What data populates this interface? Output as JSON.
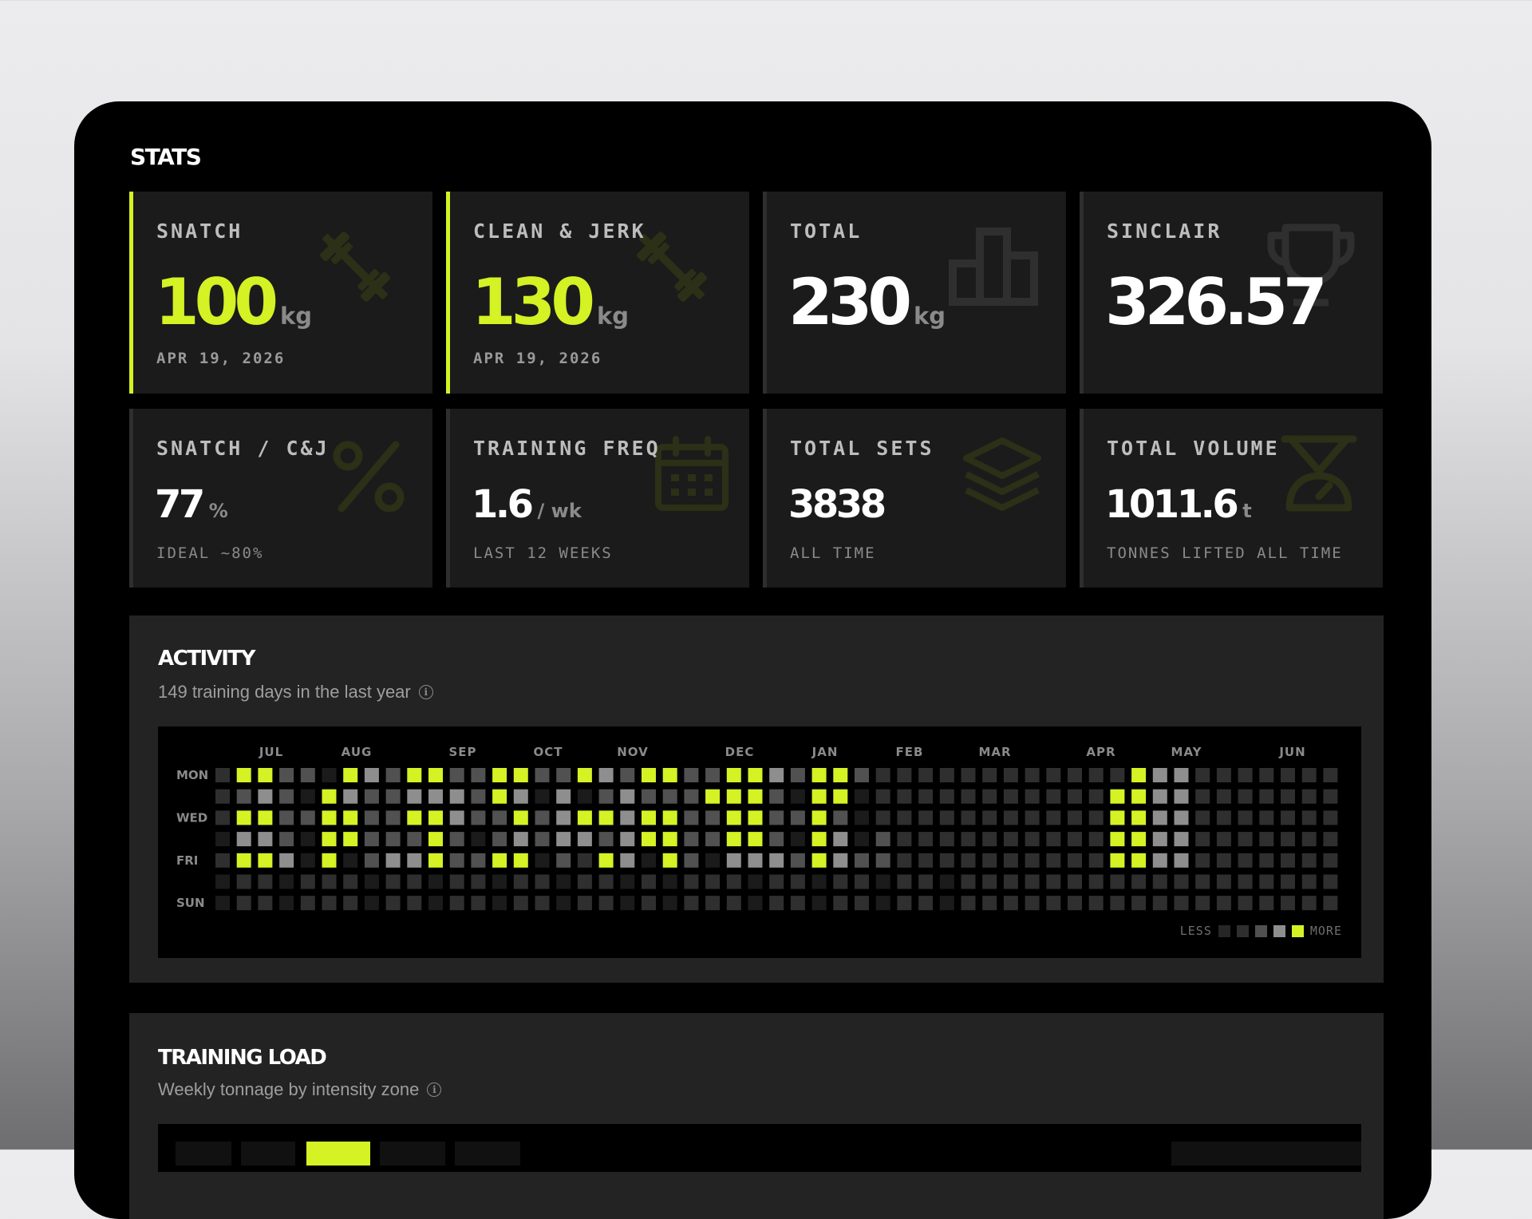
{
  "section_title": "STATS",
  "stats": [
    {
      "label": "SNATCH",
      "value": "100",
      "unit": "kg",
      "sub": "APR 19, 2026",
      "icon": "barbell-icon"
    },
    {
      "label": "CLEAN & JERK",
      "value": "130",
      "unit": "kg",
      "sub": "APR 19, 2026",
      "icon": "barbell-icon"
    },
    {
      "label": "TOTAL",
      "value": "230",
      "unit": "kg",
      "sub": "",
      "icon": "podium-icon"
    },
    {
      "label": "SINCLAIR",
      "value": "326.57",
      "unit": "",
      "sub": "",
      "icon": "trophy-icon"
    },
    {
      "label": "SNATCH / C&J",
      "value": "77",
      "unit": "%",
      "sub": "IDEAL ~80%",
      "icon": "percent-icon"
    },
    {
      "label": "TRAINING FREQ",
      "value": "1.6",
      "unit": "/ wk",
      "sub": "LAST 12 WEEKS",
      "icon": "calendar-icon"
    },
    {
      "label": "TOTAL SETS",
      "value": "3838",
      "unit": "",
      "sub": "ALL TIME",
      "icon": "layers-icon"
    },
    {
      "label": "TOTAL VOLUME",
      "value": "1011.6",
      "unit": "t",
      "sub": "TONNES LIFTED ALL TIME",
      "icon": "scale-icon"
    }
  ],
  "activity": {
    "title": "ACTIVITY",
    "subtitle": "149 training days in the last year",
    "info_icon": "info-icon",
    "months": [
      "JUL",
      "AUG",
      "SEP",
      "OCT",
      "NOV",
      "DEC",
      "JAN",
      "FEB",
      "MAR",
      "APR",
      "MAY",
      "JUN"
    ],
    "day_labels": [
      "MON",
      "",
      "WED",
      "",
      "FRI",
      "",
      "SUN"
    ],
    "legend": {
      "less": "LESS",
      "more": "MORE"
    },
    "colors": [
      "#1b1b1b",
      "#2f2f2f",
      "#515151",
      "#8e8e8e",
      "#d4f224"
    ],
    "weeks": [
      [
        1,
        1,
        1,
        0,
        1,
        0,
        0
      ],
      [
        4,
        2,
        4,
        3,
        4,
        1,
        1
      ],
      [
        4,
        3,
        4,
        3,
        4,
        1,
        1
      ],
      [
        2,
        2,
        2,
        2,
        3,
        0,
        0
      ],
      [
        2,
        0,
        2,
        0,
        0,
        1,
        1
      ],
      [
        0,
        4,
        4,
        4,
        4,
        1,
        1
      ],
      [
        4,
        3,
        4,
        4,
        0,
        1,
        1
      ],
      [
        3,
        2,
        2,
        2,
        2,
        0,
        0
      ],
      [
        2,
        2,
        2,
        2,
        3,
        1,
        1
      ],
      [
        4,
        3,
        4,
        2,
        3,
        1,
        1
      ],
      [
        4,
        3,
        4,
        4,
        4,
        0,
        0
      ],
      [
        2,
        3,
        3,
        2,
        2,
        1,
        1
      ],
      [
        2,
        2,
        2,
        0,
        2,
        1,
        1
      ],
      [
        4,
        4,
        2,
        2,
        4,
        0,
        0
      ],
      [
        4,
        3,
        4,
        3,
        4,
        1,
        1
      ],
      [
        2,
        0,
        2,
        2,
        0,
        1,
        1
      ],
      [
        2,
        3,
        3,
        3,
        2,
        0,
        0
      ],
      [
        4,
        0,
        4,
        3,
        1,
        1,
        1
      ],
      [
        3,
        2,
        4,
        2,
        4,
        1,
        1
      ],
      [
        2,
        3,
        3,
        3,
        3,
        0,
        0
      ],
      [
        4,
        2,
        4,
        4,
        0,
        1,
        1
      ],
      [
        4,
        2,
        4,
        4,
        4,
        0,
        0
      ],
      [
        2,
        2,
        2,
        2,
        2,
        1,
        1
      ],
      [
        2,
        4,
        2,
        2,
        0,
        1,
        1
      ],
      [
        4,
        4,
        4,
        4,
        3,
        1,
        1
      ],
      [
        4,
        4,
        4,
        4,
        3,
        0,
        0
      ],
      [
        3,
        2,
        2,
        2,
        3,
        1,
        1
      ],
      [
        2,
        0,
        2,
        0,
        2,
        1,
        1
      ],
      [
        4,
        4,
        4,
        4,
        4,
        0,
        0
      ],
      [
        4,
        4,
        2,
        3,
        3,
        1,
        1
      ],
      [
        2,
        0,
        0,
        0,
        2,
        1,
        1
      ],
      [
        1,
        1,
        1,
        2,
        2,
        0,
        0
      ],
      [
        1,
        1,
        1,
        1,
        1,
        1,
        1
      ],
      [
        1,
        1,
        1,
        1,
        1,
        1,
        1
      ],
      [
        1,
        1,
        1,
        1,
        1,
        0,
        0
      ],
      [
        1,
        1,
        1,
        1,
        1,
        1,
        1
      ],
      [
        1,
        1,
        1,
        1,
        1,
        1,
        1
      ],
      [
        1,
        1,
        1,
        1,
        1,
        1,
        1
      ],
      [
        1,
        1,
        1,
        1,
        1,
        1,
        1
      ],
      [
        1,
        1,
        1,
        1,
        1,
        1,
        1
      ],
      [
        1,
        1,
        1,
        1,
        1,
        1,
        1
      ],
      [
        1,
        1,
        1,
        1,
        1,
        1,
        1
      ],
      [
        1,
        4,
        4,
        4,
        4,
        1,
        1
      ],
      [
        4,
        4,
        4,
        4,
        4,
        1,
        1
      ],
      [
        3,
        3,
        3,
        3,
        3,
        1,
        1
      ],
      [
        3,
        3,
        3,
        3,
        3,
        1,
        1
      ],
      [
        1,
        1,
        1,
        1,
        1,
        1,
        1
      ],
      [
        1,
        1,
        1,
        1,
        1,
        1,
        1
      ],
      [
        1,
        1,
        1,
        1,
        1,
        1,
        1
      ],
      [
        1,
        1,
        1,
        1,
        1,
        1,
        1
      ],
      [
        1,
        1,
        1,
        1,
        1,
        1,
        1
      ],
      [
        1,
        1,
        1,
        1,
        1,
        1,
        1
      ],
      [
        1,
        1,
        1,
        1,
        1,
        1,
        1
      ]
    ]
  },
  "training_load": {
    "title": "TRAINING LOAD",
    "subtitle": "Weekly tonnage by intensity zone",
    "info_icon": "info-icon"
  }
}
